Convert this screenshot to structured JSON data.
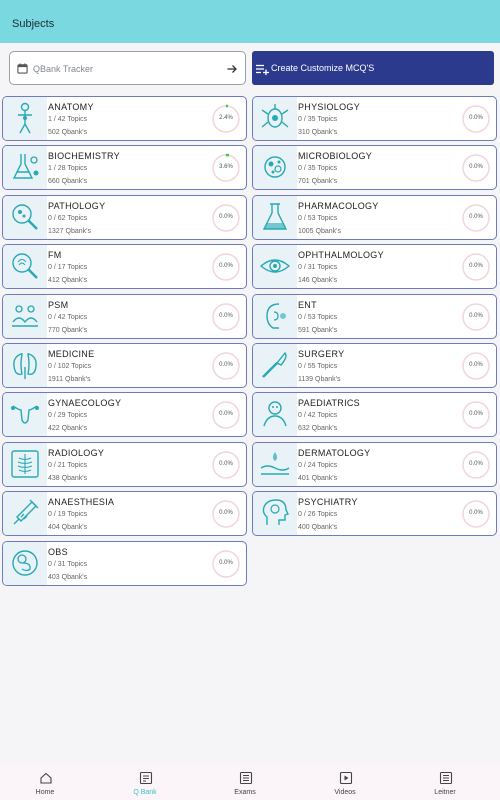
{
  "header": {
    "title": "Subjects",
    "bg_color": "#7ad9e0"
  },
  "tracker": {
    "label": "QBank Tracker",
    "icon": "calendar-icon",
    "action_icon": "arrow-right-icon"
  },
  "create_button": {
    "label": "Create Customize MCQ'S",
    "icon": "playlist-add-icon",
    "bg_color": "#2b3a8c"
  },
  "subjects": [
    {
      "name": "ANATOMY",
      "topics": "1 / 42 Topics",
      "qbank": "502 Qbank's",
      "percent": "2.4%",
      "progress": 0.024,
      "icon": "anatomy-icon"
    },
    {
      "name": "PHYSIOLOGY",
      "topics": "0 / 35 Topics",
      "qbank": "310 Qbank's",
      "percent": "0.0%",
      "progress": 0,
      "icon": "physiology-icon"
    },
    {
      "name": "BIOCHEMISTRY",
      "topics": "1 / 28 Topics",
      "qbank": "660 Qbank's",
      "percent": "3.6%",
      "progress": 0.036,
      "icon": "biochemistry-icon"
    },
    {
      "name": "MICROBIOLOGY",
      "topics": "0 / 35 Topics",
      "qbank": "701 Qbank's",
      "percent": "0.0%",
      "progress": 0,
      "icon": "microbiology-icon"
    },
    {
      "name": "PATHOLOGY",
      "topics": "0 / 62 Topics",
      "qbank": "1327 Qbank's",
      "percent": "0.0%",
      "progress": 0,
      "icon": "pathology-icon"
    },
    {
      "name": "PHARMACOLOGY",
      "topics": "0 / 53 Topics",
      "qbank": "1005 Qbank's",
      "percent": "0.0%",
      "progress": 0,
      "icon": "pharmacology-icon"
    },
    {
      "name": "FM",
      "topics": "0 / 17 Topics",
      "qbank": "412 Qbank's",
      "percent": "0.0%",
      "progress": 0,
      "icon": "forensic-icon"
    },
    {
      "name": "OPHTHALMOLOGY",
      "topics": "0 / 31 Topics",
      "qbank": "146 Qbank's",
      "percent": "0.0%",
      "progress": 0,
      "icon": "eye-icon"
    },
    {
      "name": "PSM",
      "topics": "0 / 42 Topics",
      "qbank": "770 Qbank's",
      "percent": "0.0%",
      "progress": 0,
      "icon": "psm-icon"
    },
    {
      "name": "ENT",
      "topics": "0 / 53 Topics",
      "qbank": "591 Qbank's",
      "percent": "0.0%",
      "progress": 0,
      "icon": "ent-icon"
    },
    {
      "name": "MEDICINE",
      "topics": "0 / 102 Topics",
      "qbank": "1911 Qbank's",
      "percent": "0.0%",
      "progress": 0,
      "icon": "kidney-icon"
    },
    {
      "name": "SURGERY",
      "topics": "0 / 55 Topics",
      "qbank": "1139 Qbank's",
      "percent": "0.0%",
      "progress": 0,
      "icon": "scalpel-icon"
    },
    {
      "name": "GYNAECOLOGY",
      "topics": "0 / 29 Topics",
      "qbank": "422 Qbank's",
      "percent": "0.0%",
      "progress": 0,
      "icon": "uterus-icon"
    },
    {
      "name": "PAEDIATRICS",
      "topics": "0 / 42 Topics",
      "qbank": "632 Qbank's",
      "percent": "0.0%",
      "progress": 0,
      "icon": "baby-icon"
    },
    {
      "name": "RADIOLOGY",
      "topics": "0 / 21 Topics",
      "qbank": "438 Qbank's",
      "percent": "0.0%",
      "progress": 0,
      "icon": "xray-icon"
    },
    {
      "name": "DERMATOLOGY",
      "topics": "0 / 24 Topics",
      "qbank": "401 Qbank's",
      "percent": "0.0%",
      "progress": 0,
      "icon": "skin-icon"
    },
    {
      "name": "ANAESTHESIA",
      "topics": "0 / 19 Topics",
      "qbank": "404 Qbank's",
      "percent": "0.0%",
      "progress": 0,
      "icon": "syringe-icon"
    },
    {
      "name": "PSYCHIATRY",
      "topics": "0 / 26 Topics",
      "qbank": "400 Qbank's",
      "percent": "0.0%",
      "progress": 0,
      "icon": "brain-head-icon"
    },
    {
      "name": "OBS",
      "topics": "0 / 31 Topics",
      "qbank": "403 Qbank's",
      "percent": "0.0%",
      "progress": 0,
      "icon": "fetus-icon"
    }
  ],
  "nav": [
    {
      "label": "Home",
      "icon": "home-icon",
      "active": false
    },
    {
      "label": "Q Bank",
      "icon": "qbank-icon",
      "active": true
    },
    {
      "label": "Exams",
      "icon": "exams-icon",
      "active": false
    },
    {
      "label": "Videos",
      "icon": "videos-icon",
      "active": false
    },
    {
      "label": "Leitner",
      "icon": "leitner-icon",
      "active": false
    }
  ],
  "colors": {
    "accent": "#3cc2c8",
    "progress": "#2ecc40",
    "card_border": "#6e7bbd",
    "ring_track": "#f0d5dc"
  }
}
